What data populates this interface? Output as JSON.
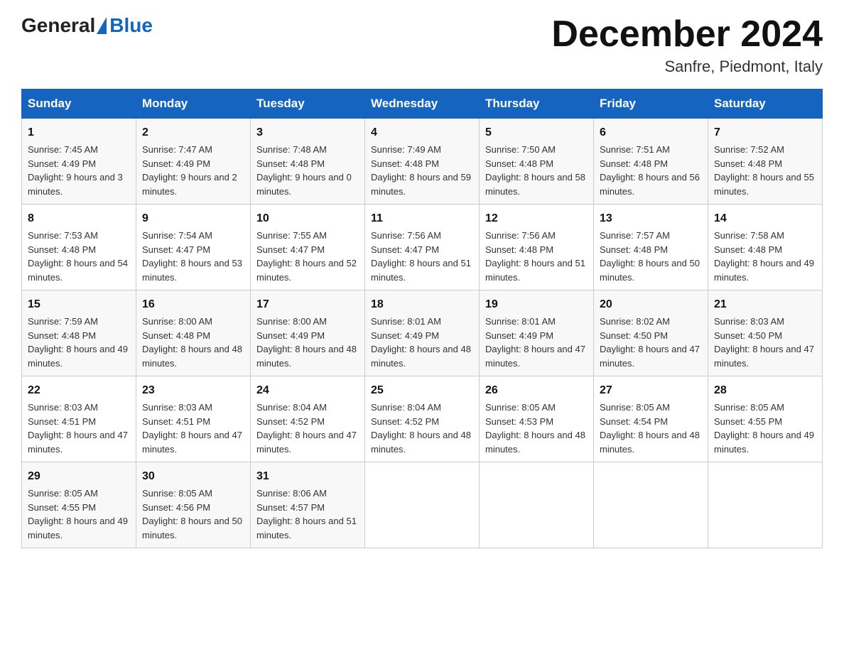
{
  "logo": {
    "general": "General",
    "blue": "Blue"
  },
  "title": "December 2024",
  "subtitle": "Sanfre, Piedmont, Italy",
  "days_of_week": [
    "Sunday",
    "Monday",
    "Tuesday",
    "Wednesday",
    "Thursday",
    "Friday",
    "Saturday"
  ],
  "weeks": [
    [
      {
        "day": "1",
        "sunrise": "7:45 AM",
        "sunset": "4:49 PM",
        "daylight": "9 hours and 3 minutes."
      },
      {
        "day": "2",
        "sunrise": "7:47 AM",
        "sunset": "4:49 PM",
        "daylight": "9 hours and 2 minutes."
      },
      {
        "day": "3",
        "sunrise": "7:48 AM",
        "sunset": "4:48 PM",
        "daylight": "9 hours and 0 minutes."
      },
      {
        "day": "4",
        "sunrise": "7:49 AM",
        "sunset": "4:48 PM",
        "daylight": "8 hours and 59 minutes."
      },
      {
        "day": "5",
        "sunrise": "7:50 AM",
        "sunset": "4:48 PM",
        "daylight": "8 hours and 58 minutes."
      },
      {
        "day": "6",
        "sunrise": "7:51 AM",
        "sunset": "4:48 PM",
        "daylight": "8 hours and 56 minutes."
      },
      {
        "day": "7",
        "sunrise": "7:52 AM",
        "sunset": "4:48 PM",
        "daylight": "8 hours and 55 minutes."
      }
    ],
    [
      {
        "day": "8",
        "sunrise": "7:53 AM",
        "sunset": "4:48 PM",
        "daylight": "8 hours and 54 minutes."
      },
      {
        "day": "9",
        "sunrise": "7:54 AM",
        "sunset": "4:47 PM",
        "daylight": "8 hours and 53 minutes."
      },
      {
        "day": "10",
        "sunrise": "7:55 AM",
        "sunset": "4:47 PM",
        "daylight": "8 hours and 52 minutes."
      },
      {
        "day": "11",
        "sunrise": "7:56 AM",
        "sunset": "4:47 PM",
        "daylight": "8 hours and 51 minutes."
      },
      {
        "day": "12",
        "sunrise": "7:56 AM",
        "sunset": "4:48 PM",
        "daylight": "8 hours and 51 minutes."
      },
      {
        "day": "13",
        "sunrise": "7:57 AM",
        "sunset": "4:48 PM",
        "daylight": "8 hours and 50 minutes."
      },
      {
        "day": "14",
        "sunrise": "7:58 AM",
        "sunset": "4:48 PM",
        "daylight": "8 hours and 49 minutes."
      }
    ],
    [
      {
        "day": "15",
        "sunrise": "7:59 AM",
        "sunset": "4:48 PM",
        "daylight": "8 hours and 49 minutes."
      },
      {
        "day": "16",
        "sunrise": "8:00 AM",
        "sunset": "4:48 PM",
        "daylight": "8 hours and 48 minutes."
      },
      {
        "day": "17",
        "sunrise": "8:00 AM",
        "sunset": "4:49 PM",
        "daylight": "8 hours and 48 minutes."
      },
      {
        "day": "18",
        "sunrise": "8:01 AM",
        "sunset": "4:49 PM",
        "daylight": "8 hours and 48 minutes."
      },
      {
        "day": "19",
        "sunrise": "8:01 AM",
        "sunset": "4:49 PM",
        "daylight": "8 hours and 47 minutes."
      },
      {
        "day": "20",
        "sunrise": "8:02 AM",
        "sunset": "4:50 PM",
        "daylight": "8 hours and 47 minutes."
      },
      {
        "day": "21",
        "sunrise": "8:03 AM",
        "sunset": "4:50 PM",
        "daylight": "8 hours and 47 minutes."
      }
    ],
    [
      {
        "day": "22",
        "sunrise": "8:03 AM",
        "sunset": "4:51 PM",
        "daylight": "8 hours and 47 minutes."
      },
      {
        "day": "23",
        "sunrise": "8:03 AM",
        "sunset": "4:51 PM",
        "daylight": "8 hours and 47 minutes."
      },
      {
        "day": "24",
        "sunrise": "8:04 AM",
        "sunset": "4:52 PM",
        "daylight": "8 hours and 47 minutes."
      },
      {
        "day": "25",
        "sunrise": "8:04 AM",
        "sunset": "4:52 PM",
        "daylight": "8 hours and 48 minutes."
      },
      {
        "day": "26",
        "sunrise": "8:05 AM",
        "sunset": "4:53 PM",
        "daylight": "8 hours and 48 minutes."
      },
      {
        "day": "27",
        "sunrise": "8:05 AM",
        "sunset": "4:54 PM",
        "daylight": "8 hours and 48 minutes."
      },
      {
        "day": "28",
        "sunrise": "8:05 AM",
        "sunset": "4:55 PM",
        "daylight": "8 hours and 49 minutes."
      }
    ],
    [
      {
        "day": "29",
        "sunrise": "8:05 AM",
        "sunset": "4:55 PM",
        "daylight": "8 hours and 49 minutes."
      },
      {
        "day": "30",
        "sunrise": "8:05 AM",
        "sunset": "4:56 PM",
        "daylight": "8 hours and 50 minutes."
      },
      {
        "day": "31",
        "sunrise": "8:06 AM",
        "sunset": "4:57 PM",
        "daylight": "8 hours and 51 minutes."
      },
      null,
      null,
      null,
      null
    ]
  ]
}
